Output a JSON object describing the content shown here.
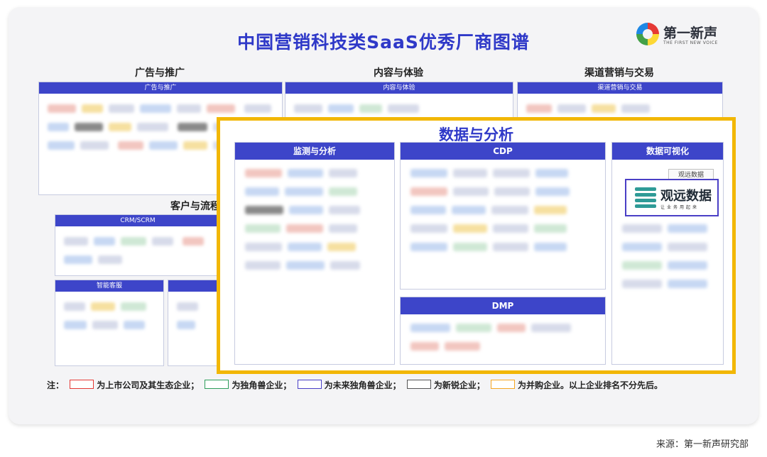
{
  "title": "中国营销科技类SaaS优秀厂商图谱",
  "logo": {
    "cn": "第一新声",
    "en": "THE FIRST NEW VOICE"
  },
  "sections": {
    "ad": {
      "heading": "广告与推广",
      "bar": "广告与推广"
    },
    "content": {
      "heading": "内容与体验",
      "bar": "内容与体验"
    },
    "channel": {
      "heading": "渠道营销与交易",
      "bar": "渠道营销与交易"
    },
    "customer": {
      "heading": "客户与流程",
      "bar": "CRM/SCRM"
    },
    "service": {
      "bar": "智能客服"
    }
  },
  "highlight": {
    "title": "数据与分析",
    "monitor": "监测与分析",
    "cdp": "CDP",
    "dmp": "DMP",
    "viz": "数据可视化",
    "tag": "观远数据",
    "brand_cn": "观远数据",
    "brand_sub": "让业务用起来"
  },
  "legend": {
    "prefix": "注：",
    "items": [
      {
        "label": "为上市公司及其生态企业；",
        "color": "#e53935"
      },
      {
        "label": "为独角兽企业；",
        "color": "#2e9e5b"
      },
      {
        "label": "为未来独角兽企业；",
        "color": "#4a3fc6"
      },
      {
        "label": "为新锐企业；",
        "color": "#555555"
      },
      {
        "label": "为并购企业。以上企业排名不分先后。",
        "color": "#f5a623"
      }
    ]
  },
  "source": "来源：第一新声研究部"
}
